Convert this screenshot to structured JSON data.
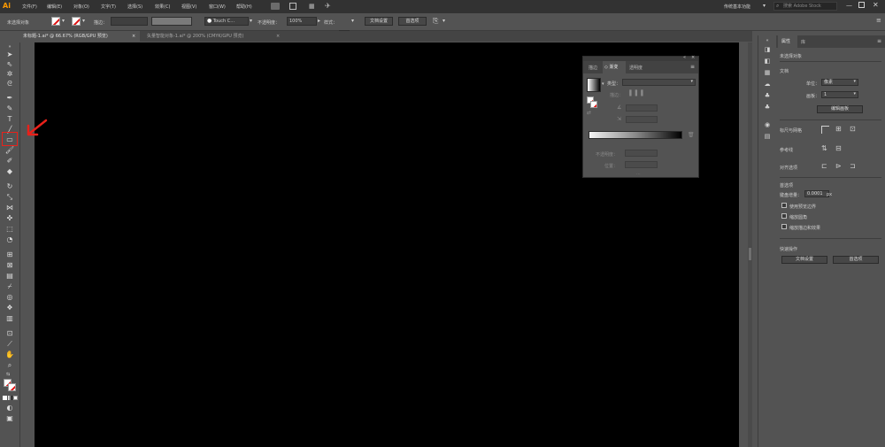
{
  "app": {
    "logo": "Ai",
    "menu": [
      "文件(F)",
      "编辑(E)",
      "对象(O)",
      "文字(T)",
      "选择(S)",
      "效果(C)",
      "视图(V)",
      "窗口(W)",
      "帮助(H)"
    ],
    "workspace": "传统基本功能",
    "stock_search_placeholder": "搜索 Adobe Stock"
  },
  "control_bar": {
    "selection_status": "未选择对象",
    "stroke_label": "描边：",
    "brush_name": "Touch C...",
    "opacity_label": "不透明度：",
    "opacity_value": "100%",
    "style_label": "样式：",
    "doc_setup_button": "文档设置",
    "preferences_button": "首选项"
  },
  "tabs": [
    {
      "label": "未标题-1.ai* @ 66.67% (RGB/GPU 预览)",
      "close": "×",
      "active": true
    },
    {
      "label": "矢量智能对象-1.ai* @ 200% (CMYK/GPU 预览)",
      "close": "×",
      "active": false
    }
  ],
  "gradient_panel": {
    "tabs": [
      "描边",
      "◇ 渐变",
      "透明度"
    ],
    "type_label": "类型：",
    "stroke_label": "描边：",
    "opacity_label": "不透明度：",
    "position_label": "位置：",
    "angle_icon": "angle-icon",
    "aspect_icon": "aspect-ratio-icon"
  },
  "properties": {
    "tabs": [
      "属性",
      "库"
    ],
    "no_selection": "未选择对象",
    "document_header": "文档",
    "units_label": "单位：",
    "units_value": "像素",
    "artboard_label": "画板：",
    "artboard_value": "1",
    "edit_artboards_button": "编辑画板",
    "rulers_label": "标尺与网格",
    "guides_label": "参考线",
    "snap_label": "对齐选项",
    "preferences_header": "首选项",
    "keyboard_increment_label": "键盘增量：",
    "keyboard_increment_value": "0.0001",
    "keyboard_increment_unit": "px",
    "checkboxes": [
      "使用预览边界",
      "缩放圆角",
      "缩放描边和效果"
    ],
    "quick_actions_header": "快速操作",
    "doc_setup_button": "文档设置",
    "preferences_button": "首选项"
  },
  "annotation": {
    "color": "#e8211a",
    "target": "rectangle-tool"
  }
}
